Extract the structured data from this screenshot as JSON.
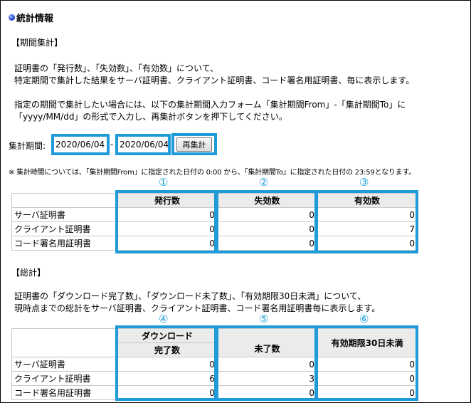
{
  "title": "統計情報",
  "period": {
    "heading": "【期間集計】",
    "desc_line1": "証明書の「発行数」、「失効数」、「有効数」について、",
    "desc_line2": "特定期間で集計した結果をサーバ証明書、クライアント証明書、コード署名用証明書、毎に表示します。",
    "instr_line1": "指定の期間で集計したい場合には、以下の集計期間入力フォーム「集計期間From」-「集計期間To」に",
    "instr_line2": "「yyyy/MM/dd」の形式で入力し、再集計ボタンを押下してください。",
    "form_label": "集計期間:",
    "from_value": "2020/06/04",
    "separator": "-",
    "to_value": "2020/06/04",
    "recalc_label": "再集計",
    "note": "※ 集計時間については、「集計期間From」に指定された日付の 0:00 から、「集計期間To」に指定された日付の 23:59となります。",
    "markers": [
      "①",
      "②",
      "③"
    ],
    "columns": [
      "発行数",
      "失効数",
      "有効数"
    ],
    "rows": [
      {
        "label": "サーバ証明書",
        "values": [
          "0",
          "0",
          "0"
        ]
      },
      {
        "label": "クライアント証明書",
        "values": [
          "0",
          "0",
          "7"
        ]
      },
      {
        "label": "コード署名用証明書",
        "values": [
          "0",
          "0",
          "0"
        ]
      }
    ]
  },
  "total": {
    "heading": "【総計】",
    "desc_line1": "証明書の「ダウンロード完了数」、「ダウンロード未了数」、「有効期限30日未満」について、",
    "desc_line2": "現時点までの総計をサーバ証明書、クライアント証明書、コード署名用証明書毎に表示します。",
    "markers": [
      "④",
      "⑤",
      "⑥"
    ],
    "col1_line1": "ダウンロード",
    "col1_line2": "完了数",
    "col2": "未了数",
    "col3": "有効期限30日未満",
    "rows": [
      {
        "label": "サーバ証明書",
        "values": [
          "0",
          "0",
          "0"
        ]
      },
      {
        "label": "クライアント証明書",
        "values": [
          "6",
          "3",
          "0"
        ]
      },
      {
        "label": "コード署名用証明書",
        "values": [
          "0",
          "0",
          "0"
        ]
      }
    ]
  },
  "colors": {
    "highlight": "#1e9bd8",
    "header_bg": "#ebebeb"
  }
}
